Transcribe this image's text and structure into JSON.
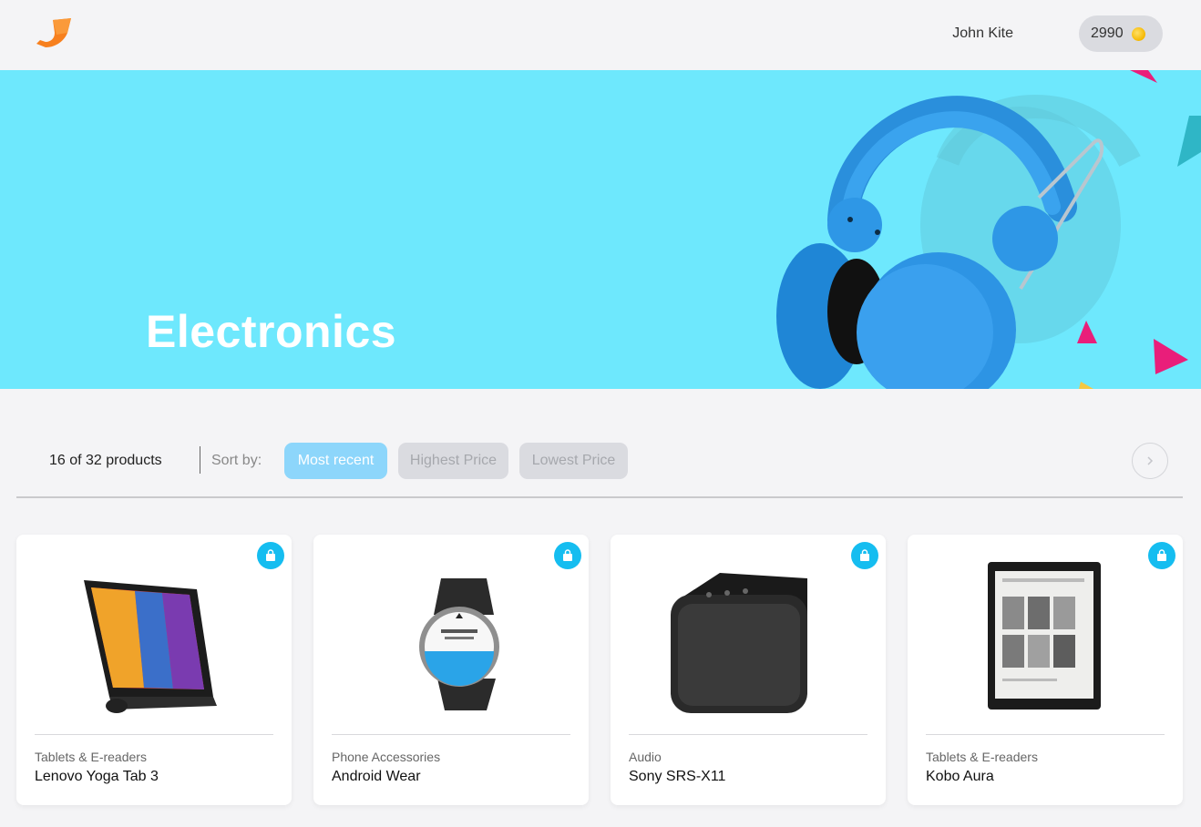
{
  "header": {
    "user_name": "John Kite",
    "points": "2990"
  },
  "banner": {
    "title": "Electronics"
  },
  "toolbar": {
    "count": "16 of 32 products",
    "sort_label": "Sort by:",
    "sort_options": [
      "Most recent",
      "Highest Price",
      "Lowest Price"
    ],
    "active_sort": "Most recent"
  },
  "products": [
    {
      "category": "Tablets & E-readers",
      "name": "Lenovo Yoga Tab 3"
    },
    {
      "category": "Phone Accessories",
      "name": "Android Wear"
    },
    {
      "category": "Audio",
      "name": "Sony SRS-X11"
    },
    {
      "category": "Tablets & E-readers",
      "name": "Kobo Aura"
    }
  ],
  "colors": {
    "accent": "#15bdf0",
    "banner_bg": "#6ee8fd",
    "sort_active": "#8dd6fb",
    "logo": "#f7801e"
  }
}
